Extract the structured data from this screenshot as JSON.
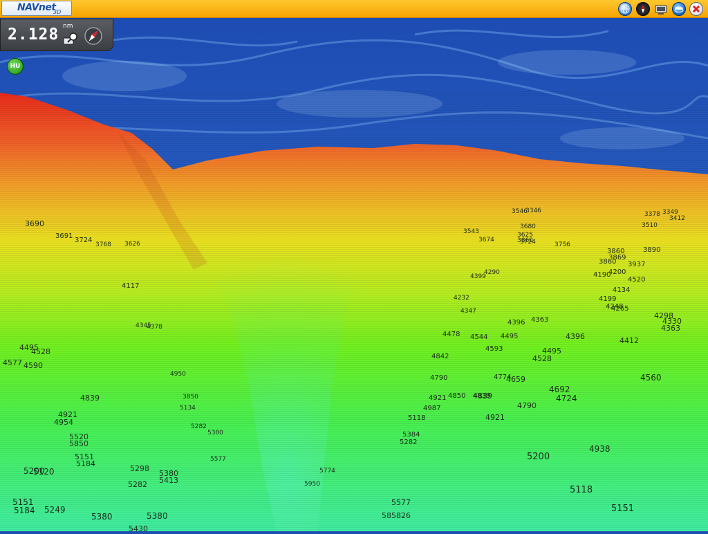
{
  "app": {
    "logo": "NAVnet",
    "logo_suffix": "3D"
  },
  "toolbar": {
    "icons": [
      "globe-icon",
      "compass-icon",
      "monitor-icon",
      "layers-icon",
      "close-icon"
    ]
  },
  "range_box": {
    "value": "2.128",
    "unit": "nm"
  },
  "orientation_button": {
    "label": "HU"
  },
  "colors": {
    "toolbar": "#f5a400",
    "shallow": "#e8261e",
    "mid": "#e8e020",
    "deep": "#40f020",
    "deepest": "#50f0c0",
    "sky": "#2456b8"
  },
  "depth_soundings": [
    [
      "3690",
      0
    ],
    [
      "3691",
      0
    ],
    [
      "3724",
      0
    ],
    [
      "3768",
      0
    ],
    [
      "3626",
      0
    ],
    [
      "4117",
      0
    ],
    [
      "4345",
      0
    ],
    [
      "4378",
      0
    ],
    [
      "4495",
      0
    ],
    [
      "4528",
      0
    ],
    [
      "4577",
      0
    ],
    [
      "4590",
      0
    ],
    [
      "4839",
      0
    ],
    [
      "4921",
      0
    ],
    [
      "4954",
      0
    ],
    [
      "5520",
      0
    ],
    [
      "5850",
      0
    ],
    [
      "5151",
      0
    ],
    [
      "5184",
      0
    ],
    [
      "5200",
      0
    ],
    [
      "5120",
      0
    ],
    [
      "5298",
      0
    ],
    [
      "5282",
      0
    ],
    [
      "5151",
      0
    ],
    [
      "5184",
      0
    ],
    [
      "5249",
      0
    ],
    [
      "5380",
      0
    ],
    [
      "5380",
      0
    ],
    [
      "5413",
      0
    ],
    [
      "5380",
      0
    ],
    [
      "5430",
      0
    ],
    [
      "4950",
      0
    ],
    [
      "5134",
      0
    ],
    [
      "3850",
      0
    ],
    [
      "5282",
      0
    ],
    [
      "5380",
      0
    ],
    [
      "5774",
      0
    ],
    [
      "5950",
      0
    ],
    [
      "5577",
      0
    ],
    [
      "585826",
      0
    ],
    [
      "5577",
      0
    ],
    [
      "5200",
      0
    ],
    [
      "5118",
      0
    ],
    [
      "4938",
      0
    ],
    [
      "5151",
      0
    ],
    [
      "4560",
      0
    ],
    [
      "4692",
      0
    ],
    [
      "4724",
      0
    ],
    [
      "4839",
      0
    ],
    [
      "4790",
      0
    ],
    [
      "4921",
      0
    ],
    [
      "4659",
      0
    ],
    [
      "4774",
      0
    ],
    [
      "4528",
      0
    ],
    [
      "4495",
      0
    ],
    [
      "4396",
      0
    ],
    [
      "4363",
      0
    ],
    [
      "4396",
      0
    ],
    [
      "4593",
      0
    ],
    [
      "4495",
      0
    ],
    [
      "4478",
      0
    ],
    [
      "4544",
      0
    ],
    [
      "4842",
      0
    ],
    [
      "4790",
      0
    ],
    [
      "4987",
      0
    ],
    [
      "4921",
      0
    ],
    [
      "4850",
      0
    ],
    [
      "4839",
      0
    ],
    [
      "5118",
      0
    ],
    [
      "5384",
      0
    ],
    [
      "5282",
      0
    ],
    [
      "4298",
      0
    ],
    [
      "4330",
      0
    ],
    [
      "4363",
      0
    ],
    [
      "4412",
      0
    ],
    [
      "4199",
      0
    ],
    [
      "4134",
      0
    ],
    [
      "4248",
      0
    ],
    [
      "4265",
      0
    ],
    [
      "4520",
      0
    ],
    [
      "4190",
      0
    ],
    [
      "4200",
      0
    ],
    [
      "3860",
      0
    ],
    [
      "3869",
      0
    ],
    [
      "3860",
      0
    ],
    [
      "3937",
      0
    ],
    [
      "3890",
      0
    ],
    [
      "3510",
      0
    ],
    [
      "3378",
      0
    ],
    [
      "3349",
      0
    ],
    [
      "3412",
      0
    ],
    [
      "3860",
      0
    ],
    [
      "3546",
      0
    ],
    [
      "3756",
      0
    ],
    [
      "3724",
      0
    ],
    [
      "3625",
      0
    ],
    [
      "3680",
      0
    ],
    [
      "3674",
      0
    ],
    [
      "3543",
      0
    ],
    [
      "3346",
      0
    ],
    [
      "4399",
      0
    ],
    [
      "4290",
      0
    ],
    [
      "4232",
      0
    ],
    [
      "4347",
      0
    ]
  ]
}
